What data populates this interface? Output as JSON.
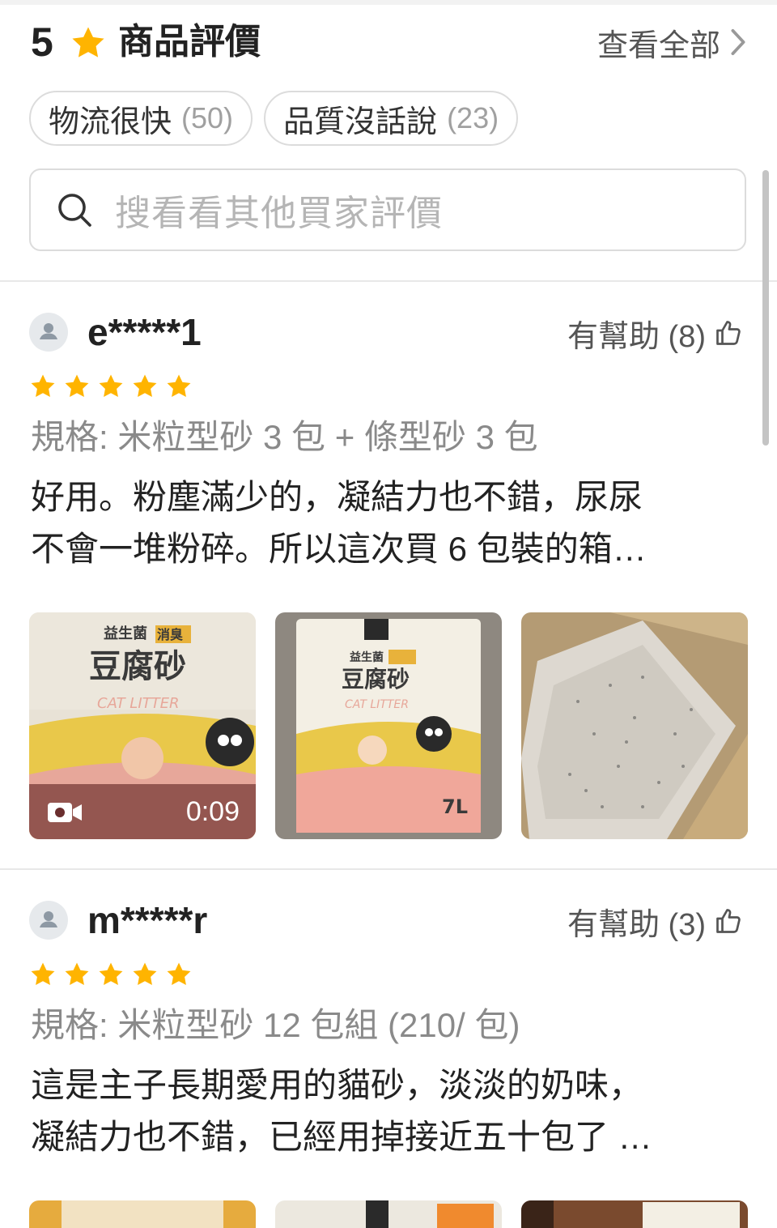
{
  "header": {
    "rating": "5",
    "title": "商品評價",
    "view_all": "查看全部",
    "accent_color": "#FFB400"
  },
  "chips": [
    {
      "label": "物流很快",
      "count": "(50)"
    },
    {
      "label": "品質沒話說",
      "count": "(23)"
    }
  ],
  "search": {
    "placeholder": "搜看看其他買家評價",
    "icon": "search-icon"
  },
  "reviews": [
    {
      "username": "e*****1",
      "helpful": "有幫助 (8)",
      "stars": 5,
      "spec": "規格: 米粒型砂 3 包 + 條型砂 3 包",
      "lines": [
        "好用。粉塵滿少的，凝結力也不錯，尿尿",
        "不會一堆粉碎。所以這次買 6 包裝的箱…"
      ],
      "media": [
        {
          "kind": "video",
          "duration": "0:09",
          "icon": "video-camera-icon"
        },
        {
          "kind": "image"
        },
        {
          "kind": "image"
        }
      ]
    },
    {
      "username": "m*****r",
      "helpful": "有幫助 (3)",
      "stars": 5,
      "spec": "規格: 米粒型砂 12 包組 (210/ 包)",
      "lines": [
        "這是主子長期愛用的貓砂，淡淡的奶味，",
        "凝結力也不錯，已經用掉接近五十包了 …"
      ],
      "media": [
        {
          "kind": "image"
        },
        {
          "kind": "image"
        },
        {
          "kind": "image"
        }
      ]
    }
  ]
}
